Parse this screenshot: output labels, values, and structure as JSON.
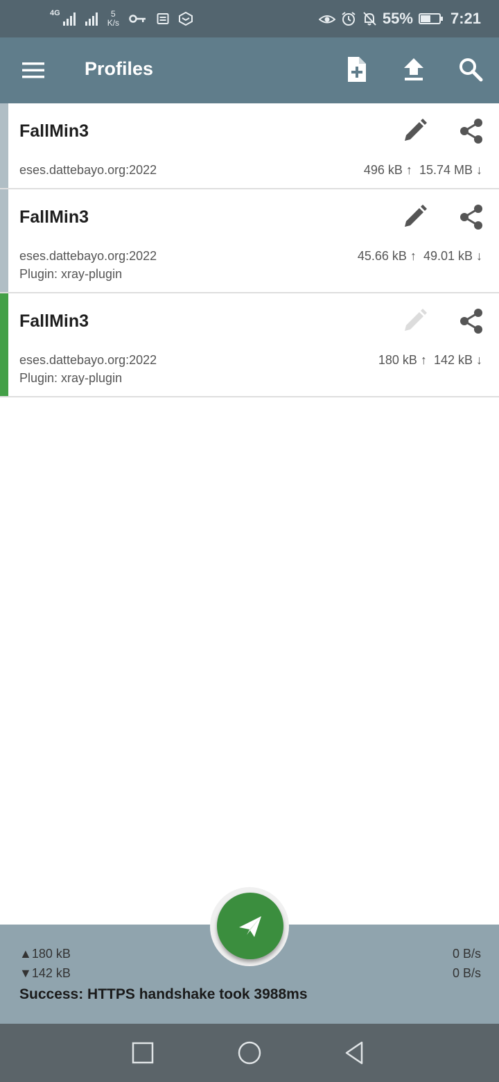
{
  "status_bar": {
    "network_type": "4G",
    "speed_value": "5",
    "speed_unit": "K/s",
    "battery": "55%",
    "battery_level": 0.55,
    "time": "7:21"
  },
  "app_bar": {
    "title": "Profiles"
  },
  "profiles": [
    {
      "name": "FallMin3",
      "address": "eses.dattebayo.org:2022",
      "plugin": "",
      "upload": "496 kB ↑",
      "download": "15.74 MB ↓",
      "active": false,
      "edit_enabled": true
    },
    {
      "name": "FallMin3",
      "address": "eses.dattebayo.org:2022",
      "plugin": "Plugin: xray-plugin",
      "upload": "45.66 kB ↑",
      "download": "49.01 kB ↓",
      "active": false,
      "edit_enabled": true
    },
    {
      "name": "FallMin3",
      "address": "eses.dattebayo.org:2022",
      "plugin": "Plugin: xray-plugin",
      "upload": "180 kB ↑",
      "download": "142 kB ↓",
      "active": true,
      "edit_enabled": false
    }
  ],
  "stats": {
    "tx_total": "▲180 kB",
    "rx_total": "▼142 kB",
    "tx_rate": "0 B/s",
    "rx_rate": "0 B/s",
    "message": "Success: HTTPS handshake took 3988ms"
  },
  "colors": {
    "app_bar": "#607d8b",
    "status_bar": "#53656f",
    "accent_green": "#43a047",
    "fab": "#3b8e3e",
    "bottom_panel": "#90a4ae",
    "inactive_marker": "#b0bec5"
  }
}
